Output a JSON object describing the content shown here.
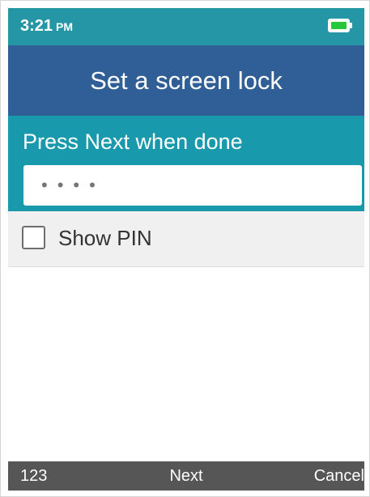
{
  "status_bar": {
    "time": "3:21",
    "ampm": "PM",
    "battery_level": 1.0,
    "battery_color": "#27c63b",
    "battery_icon": "battery-icon"
  },
  "header": {
    "title": "Set a screen lock"
  },
  "pin_entry": {
    "prompt": "Press Next when done",
    "masked_value": "••••"
  },
  "show_pin": {
    "label": "Show PIN",
    "checked": false
  },
  "softkeys": {
    "left": "123",
    "center": "Next",
    "right": "Cancel"
  },
  "colors": {
    "status_bar": "#2596a5",
    "title_bar": "#2f5f96",
    "entry_area": "#1999ac",
    "softkey_bar": "#565656"
  }
}
